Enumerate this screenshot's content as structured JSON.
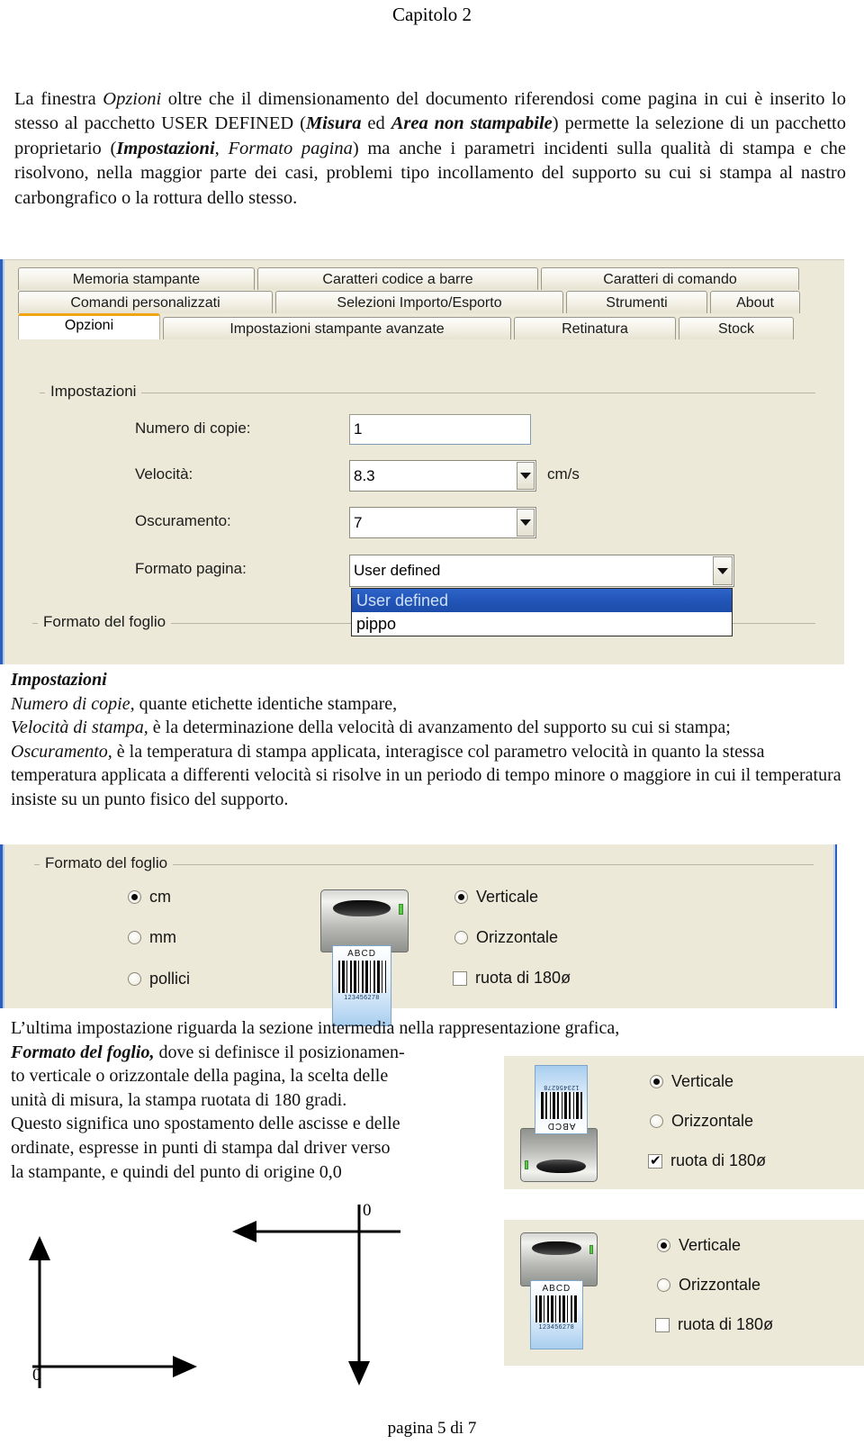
{
  "page": {
    "chapter_header": "Capitolo 2",
    "footer": "pagina 5 di 7"
  },
  "intro_paragraph": {
    "seg1": "La finestra ",
    "seg2_italic": "Opzioni",
    "seg3": " oltre che il dimensionamento del documento riferendosi come pagina in cui è inserito lo stesso al pacchetto USER DEFINED (",
    "seg4_bolditalic": "Misura",
    "seg5": " ed ",
    "seg6_bolditalic": "Area non stampabile",
    "seg7": ") permette la selezione di un pacchetto proprietario (",
    "seg8_bolditalic": "Impostazioni",
    "seg9": ", ",
    "seg10_italic": "Formato pagina",
    "seg11": ") ma anche i parametri incidenti sulla qualità di stampa e che risolvono, nella maggior parte dei casi, problemi tipo incollamento del supporto su cui si stampa al nastro carbongrafico o la rottura dello stesso."
  },
  "mid_paragraph": {
    "heading_bolditalic": "Impostazioni",
    "l1_italic": "Numero di copie,",
    "l1_rest": " quante etichette identiche stampare,",
    "l2_italic": "Velocità di stampa,",
    "l2_rest": " è la determinazione della velocità di avanzamento del supporto su cui si stampa;",
    "l3_italic": "Oscuramento,",
    "l3_rest": " è la temperatura di stampa applicata, interagisce col parametro velocità in quanto la stessa temperatura applicata a differenti velocità si risolve in un periodo di tempo minore o maggiore in cui il temperatura insiste su un punto fisico del supporto."
  },
  "bottom_paragraph": {
    "l1": "L’ultima impostazione riguarda la sezione intermedia nella rappresentazione grafica,",
    "l2_bolditalic": "Formato del foglio,",
    "l2_rest": " dove si definisce il posizionamen-",
    "l3": "to verticale o orizzontale della pagina, la scelta delle",
    "l4": "unità di misura, la stampa ruotata di 180 gradi.",
    "l5": "Questo significa uno spostamento delle ascisse e delle",
    "l6": "ordinate, espresse in punti di stampa dal driver verso",
    "l7": "la stampante, e quindi del punto di origine 0,0"
  },
  "dialog_opzioni": {
    "tab_rows": [
      [
        "Memoria stampante",
        "Caratteri codice a barre",
        "Caratteri di comando"
      ],
      [
        "Comandi personalizzati",
        "Selezioni Importo/Esporto",
        "Strumenti",
        "About"
      ],
      [
        "Opzioni",
        "Impostazioni stampante avanzate",
        "Retinatura",
        "Stock"
      ]
    ],
    "active_tab": "Opzioni",
    "groupbox_impostazioni_title": "Impostazioni",
    "groupbox_formato_foglio_title": "Formato del foglio",
    "fields": {
      "numero_copie_label": "Numero di copie:",
      "numero_copie_value": "1",
      "velocita_label": "Velocità:",
      "velocita_value": "8.3",
      "velocita_unit": "cm/s",
      "oscuramento_label": "Oscuramento:",
      "oscuramento_value": "7",
      "formato_pagina_label": "Formato pagina:",
      "formato_pagina_value": "User defined"
    },
    "formato_pagina_options": [
      {
        "label": "User defined",
        "selected": true
      },
      {
        "label": "pippo",
        "selected": false
      }
    ]
  },
  "dialog_formato_foglio": {
    "groupbox_title": "Formato del foglio",
    "units": [
      {
        "label": "cm",
        "checked": true
      },
      {
        "label": "mm",
        "checked": false
      },
      {
        "label": "pollici",
        "checked": false
      }
    ],
    "orientation": [
      {
        "label": "Verticale",
        "checked": true
      },
      {
        "label": "Orizzontale",
        "checked": false
      }
    ],
    "rotate_label": "ruota di 180ø",
    "rotate_checked": false,
    "printer_label_text": "ABCD",
    "printer_label_number": "123456278"
  },
  "panel_rotated": {
    "orientation": [
      {
        "label": "Verticale",
        "checked": true
      },
      {
        "label": "Orizzontale",
        "checked": false
      }
    ],
    "rotate_label": "ruota di 180ø",
    "rotate_checked": true,
    "printer_label_text": "ABCD",
    "printer_label_number": "123456278"
  },
  "panel_normal": {
    "orientation": [
      {
        "label": "Verticale",
        "checked": true
      },
      {
        "label": "Orizzontale",
        "checked": false
      }
    ],
    "rotate_label": "ruota di 180ø",
    "rotate_checked": false,
    "printer_label_text": "ABCD",
    "printer_label_number": "123456278"
  },
  "diagrams": {
    "left_origin_label": "0",
    "right_origin_label": "0"
  },
  "colors": {
    "dialog_bg": "#ECE9D8",
    "tab_active_accent": "#F0A510",
    "selection_blue": "#2255B8",
    "dialog_border_blue": "#2A5FC0"
  }
}
